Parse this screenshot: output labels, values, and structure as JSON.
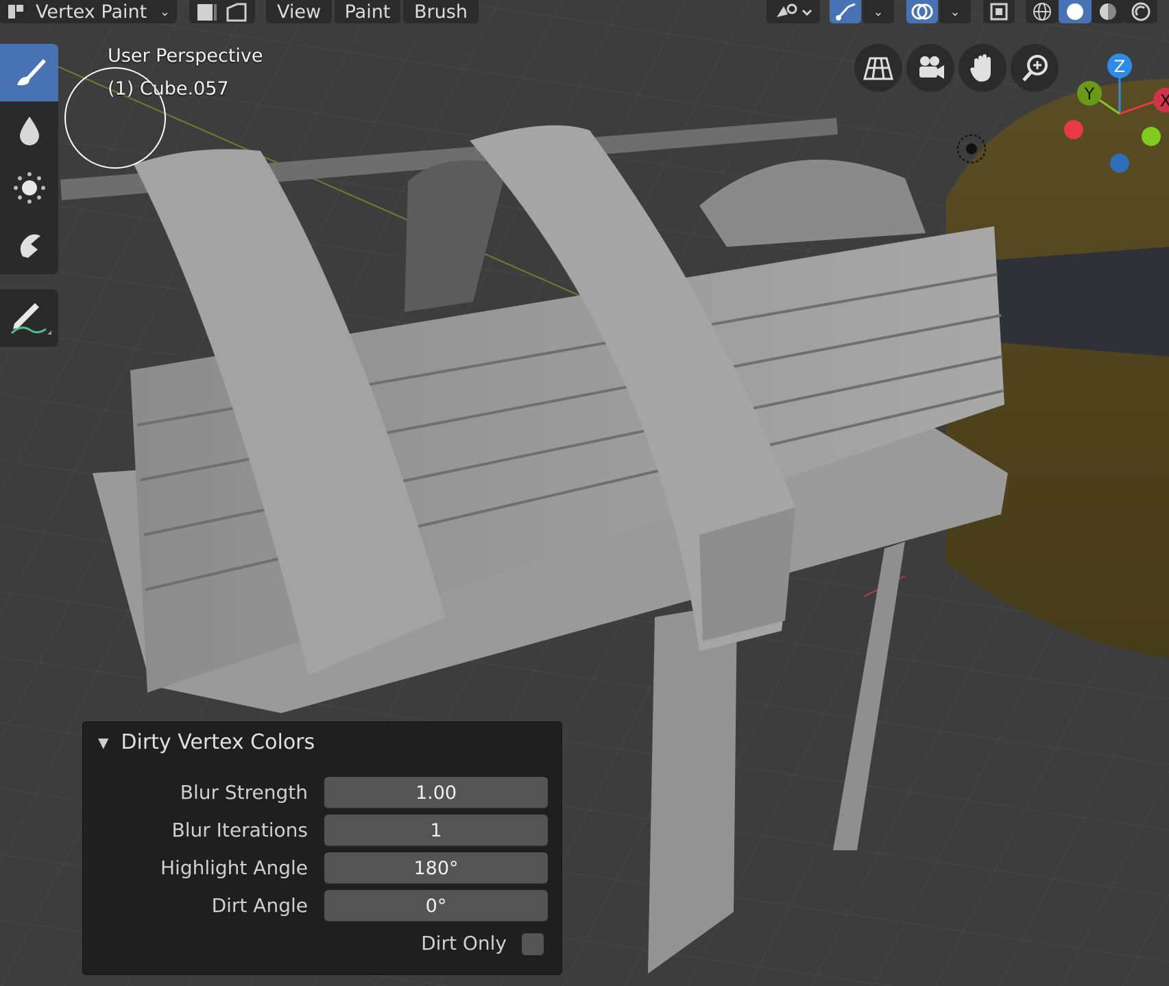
{
  "header": {
    "mode": "Vertex Paint",
    "menu": [
      "View",
      "Paint",
      "Brush"
    ]
  },
  "toolbar": {
    "tools": [
      "draw-brush",
      "blur",
      "average",
      "smear"
    ],
    "annotate": "annotate"
  },
  "viewport": {
    "view_name": "User Perspective",
    "object_name": "(1) Cube.057"
  },
  "gizmo": {
    "z": "Z",
    "y": "Y",
    "x": "X",
    "colors": {
      "x": "#e8394b",
      "y": "#7fcc1f",
      "z": "#2d8ceb"
    }
  },
  "redo_panel": {
    "title": "Dirty Vertex Colors",
    "fields": [
      {
        "label": "Blur Strength",
        "value": "1.00"
      },
      {
        "label": "Blur Iterations",
        "value": "1"
      },
      {
        "label": "Highlight Angle",
        "value": "180°"
      },
      {
        "label": "Dirt Angle",
        "value": "0°"
      }
    ],
    "dirt_only_label": "Dirt Only",
    "dirt_only": false
  },
  "colors": {
    "accent": "#4772b3",
    "background": "#3a3a3a"
  }
}
